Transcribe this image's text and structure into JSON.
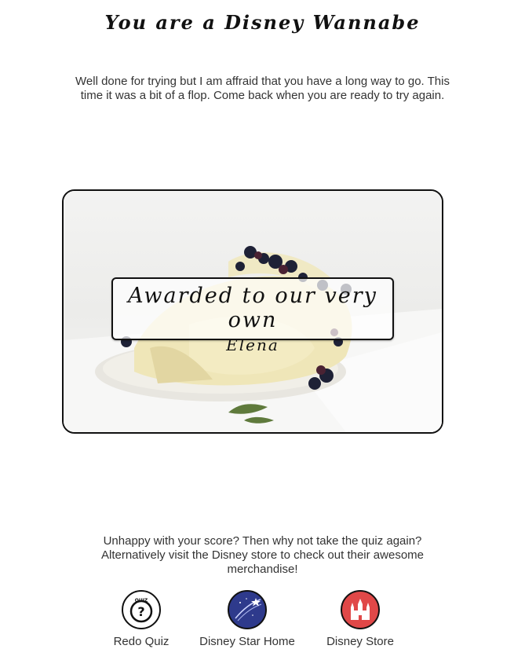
{
  "page": {
    "title": "You are a Disney Wannabe",
    "intro": "Well done for trying but I am affraid that you have a long way to go. This time it was a bit of a flop. Come back when you are ready to try again."
  },
  "award": {
    "line1": "Awarded to our very own",
    "line2": "Elena"
  },
  "outro": "Unhappy with your score? Then why not take the quiz again? Alternatively visit the Disney store to check out their awesome merchandise!",
  "links": [
    {
      "label": "Redo Quiz",
      "icon": "quiz-icon"
    },
    {
      "label": "Disney Star Home",
      "icon": "star-home-icon"
    },
    {
      "label": "Disney Store",
      "icon": "castle-icon"
    }
  ],
  "icon_text": {
    "quiz": "QUIZ"
  },
  "colors": {
    "star_home_bg": "#2e3a8c",
    "store_bg": "#e04848"
  }
}
